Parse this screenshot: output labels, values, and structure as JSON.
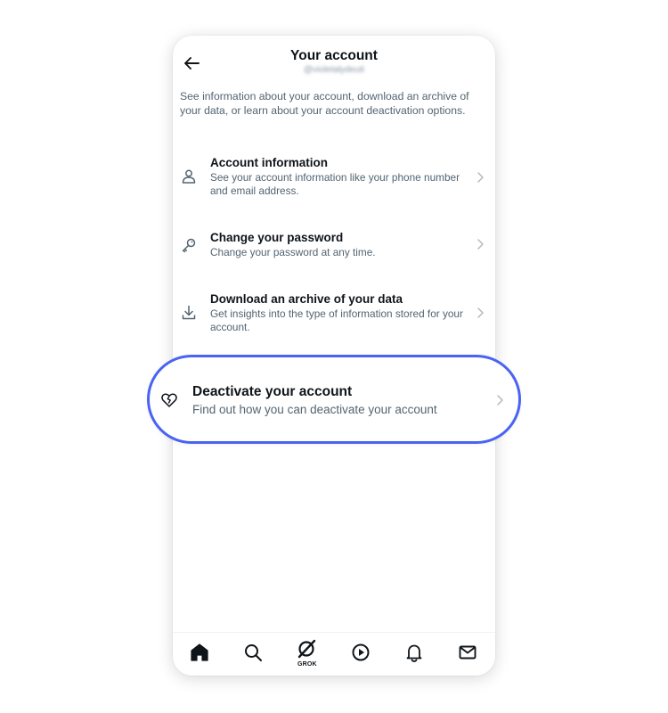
{
  "header": {
    "title": "Your account",
    "handle": "@violetalydeuti"
  },
  "intro": "See information about your account, download an archive of your data, or learn about your account deactivation options.",
  "items": [
    {
      "title": "Account information",
      "subtitle": "See your account information like your phone number and email address.",
      "icon": "person-icon"
    },
    {
      "title": "Change your password",
      "subtitle": "Change your password at any time.",
      "icon": "key-icon"
    },
    {
      "title": "Download an archive of your data",
      "subtitle": "Get insights into the type of information stored for your account.",
      "icon": "download-icon"
    }
  ],
  "highlight": {
    "title": "Deactivate your account",
    "subtitle": "Find out how you can deactivate your account",
    "icon": "broken-heart-icon",
    "border_color": "#4a63f2"
  },
  "nav": {
    "items": [
      "home-icon",
      "search-icon",
      "grok-icon",
      "play-icon",
      "bell-icon",
      "mail-icon"
    ],
    "grok_label": "GROK"
  }
}
